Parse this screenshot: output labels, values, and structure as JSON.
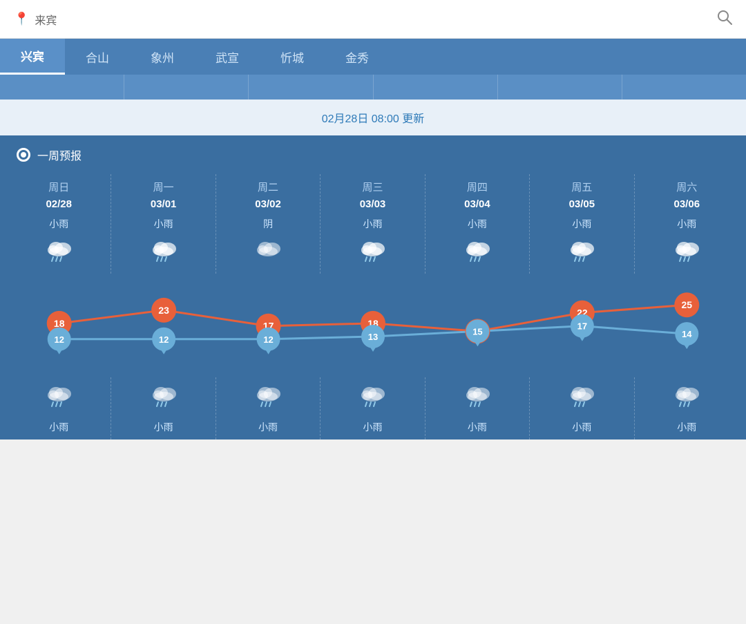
{
  "header": {
    "location": "来宾",
    "search_icon": "🔍"
  },
  "tabs": [
    {
      "label": "兴宾",
      "active": true
    },
    {
      "label": "合山",
      "active": false
    },
    {
      "label": "象州",
      "active": false
    },
    {
      "label": "武宣",
      "active": false
    },
    {
      "label": "忻城",
      "active": false
    },
    {
      "label": "金秀",
      "active": false
    }
  ],
  "update_text": "02月28日 08:00 更新",
  "forecast_label": "一周预报",
  "days": [
    {
      "name": "周日",
      "date": "02/28",
      "weather": "小雨",
      "high": 18,
      "low": 12,
      "bottom_weather": "小雨"
    },
    {
      "name": "周一",
      "date": "03/01",
      "weather": "小雨",
      "high": 23,
      "low": 12,
      "bottom_weather": "小雨"
    },
    {
      "name": "周二",
      "date": "03/02",
      "weather": "阴",
      "high": 17,
      "low": 12,
      "bottom_weather": "小雨"
    },
    {
      "name": "周三",
      "date": "03/03",
      "weather": "小雨",
      "high": 18,
      "low": 13,
      "bottom_weather": "小雨"
    },
    {
      "name": "周四",
      "date": "03/04",
      "weather": "小雨",
      "high": 15,
      "low": 15,
      "bottom_weather": "小雨"
    },
    {
      "name": "周五",
      "date": "03/05",
      "weather": "小雨",
      "high": 22,
      "low": 17,
      "bottom_weather": "小雨"
    },
    {
      "name": "周六",
      "date": "03/06",
      "weather": "小雨",
      "high": 25,
      "low": 14,
      "bottom_weather": "小雨"
    }
  ],
  "colors": {
    "panel_bg": "#3a6ea0",
    "tab_active": "#5a90c8",
    "tab_bg": "#4a7fb5",
    "high_color": "#e8603a",
    "low_color": "#6aaed8"
  }
}
